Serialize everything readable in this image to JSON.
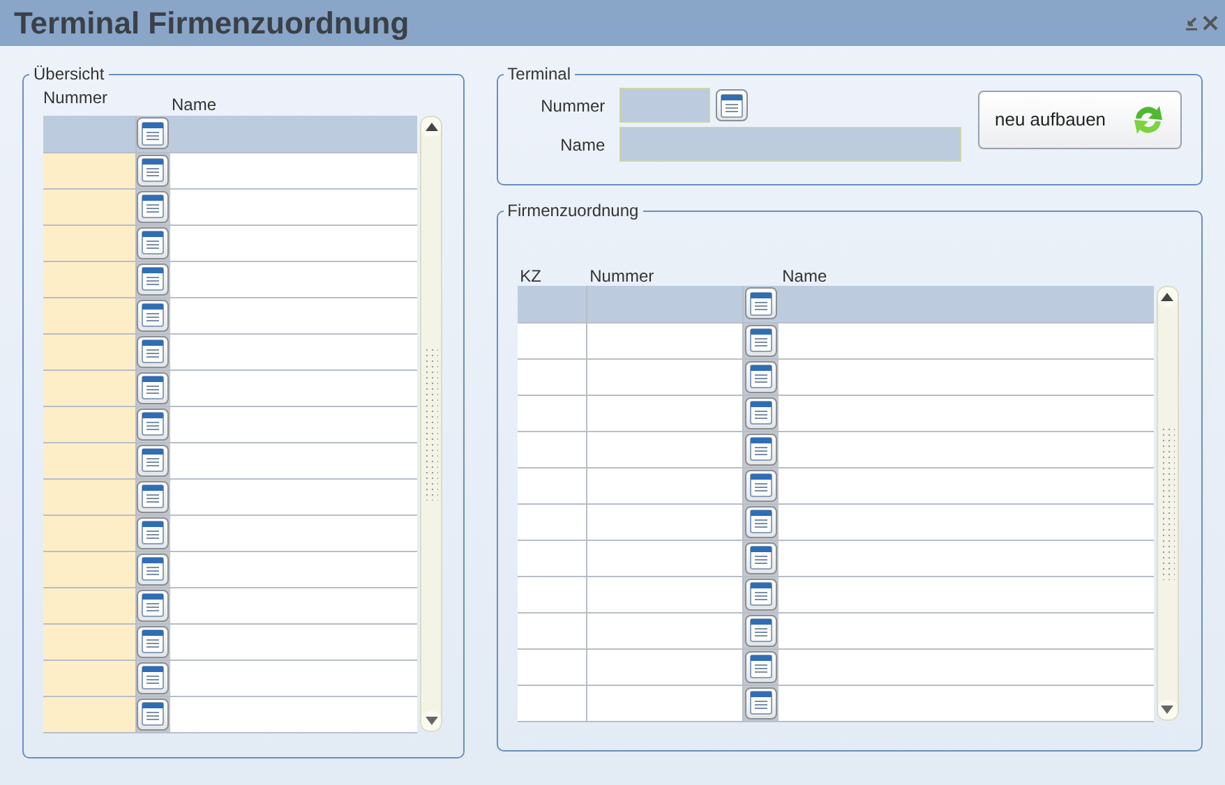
{
  "window": {
    "title": "Terminal Firmenzuordnung"
  },
  "overview": {
    "legend": "Übersicht",
    "columns": [
      "Nummer",
      "Name"
    ],
    "rows": [
      {
        "selected": true
      },
      {
        "selected": false
      },
      {
        "selected": false
      },
      {
        "selected": false
      },
      {
        "selected": false
      },
      {
        "selected": false
      },
      {
        "selected": false
      },
      {
        "selected": false
      },
      {
        "selected": false
      },
      {
        "selected": false
      },
      {
        "selected": false
      },
      {
        "selected": false
      },
      {
        "selected": false
      },
      {
        "selected": false
      },
      {
        "selected": false
      },
      {
        "selected": false
      },
      {
        "selected": false
      }
    ]
  },
  "terminal": {
    "legend": "Terminal",
    "fields": [
      {
        "label": "Nummer",
        "lookup": true
      },
      {
        "label": "Name",
        "lookup": false
      }
    ],
    "button": "neu aufbauen"
  },
  "assignment": {
    "legend": "Firmenzuordnung",
    "columns": [
      "KZ",
      "Nummer",
      "Name"
    ],
    "rows": [
      {
        "selected": true
      },
      {
        "selected": false
      },
      {
        "selected": false
      },
      {
        "selected": false
      },
      {
        "selected": false
      },
      {
        "selected": false
      },
      {
        "selected": false
      },
      {
        "selected": false
      },
      {
        "selected": false
      },
      {
        "selected": false
      },
      {
        "selected": false
      },
      {
        "selected": false
      }
    ]
  }
}
